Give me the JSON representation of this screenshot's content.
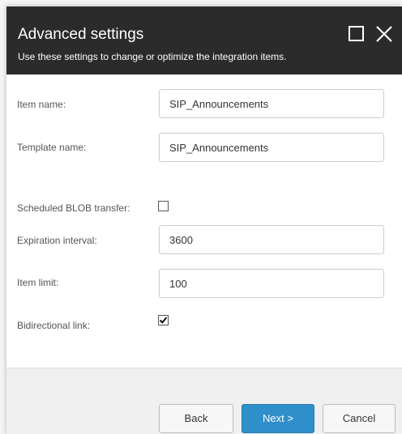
{
  "dialog": {
    "title": "Advanced settings",
    "subtitle": "Use these settings to change or optimize the integration items."
  },
  "form": {
    "item_name_label": "Item name:",
    "item_name_value": "SIP_Announcements",
    "template_name_label": "Template name:",
    "template_name_value": "SIP_Announcements",
    "scheduled_blob_label": "Scheduled BLOB transfer:",
    "scheduled_blob_checked": false,
    "expiration_label": "Expiration interval:",
    "expiration_value": "3600",
    "item_limit_label": "Item limit:",
    "item_limit_value": "100",
    "bidirectional_label": "Bidirectional link:",
    "bidirectional_checked": true
  },
  "footer": {
    "back_label": "Back",
    "next_label": "Next >",
    "cancel_label": "Cancel"
  },
  "colors": {
    "header_bg": "#2b2b2b",
    "primary_button": "#2f8fca"
  },
  "icons": {
    "maximize": "maximize-icon",
    "close": "close-icon",
    "check": "check-icon"
  }
}
